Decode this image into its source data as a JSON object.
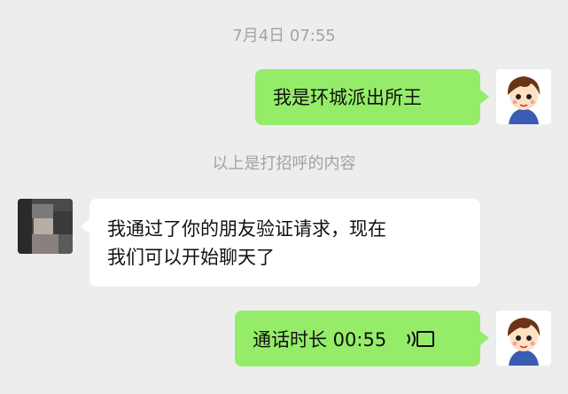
{
  "chat": {
    "timestamp": "7月4日 07:55",
    "messages": [
      {
        "sender": "self",
        "type": "text",
        "text": "我是环城派出所王"
      },
      {
        "type": "system",
        "text": "以上是打招呼的内容"
      },
      {
        "sender": "other",
        "type": "text",
        "lines": [
          "我通过了你的朋友验证请求，现在",
          "我们可以开始聊天了"
        ]
      },
      {
        "sender": "self",
        "type": "call",
        "text": "通话时长 00:55",
        "icon": "phone-call-icon"
      }
    ]
  },
  "colors": {
    "background": "#ededed",
    "self_bubble": "#95ec69",
    "other_bubble": "#ffffff",
    "system_text": "#a3a3a3"
  }
}
